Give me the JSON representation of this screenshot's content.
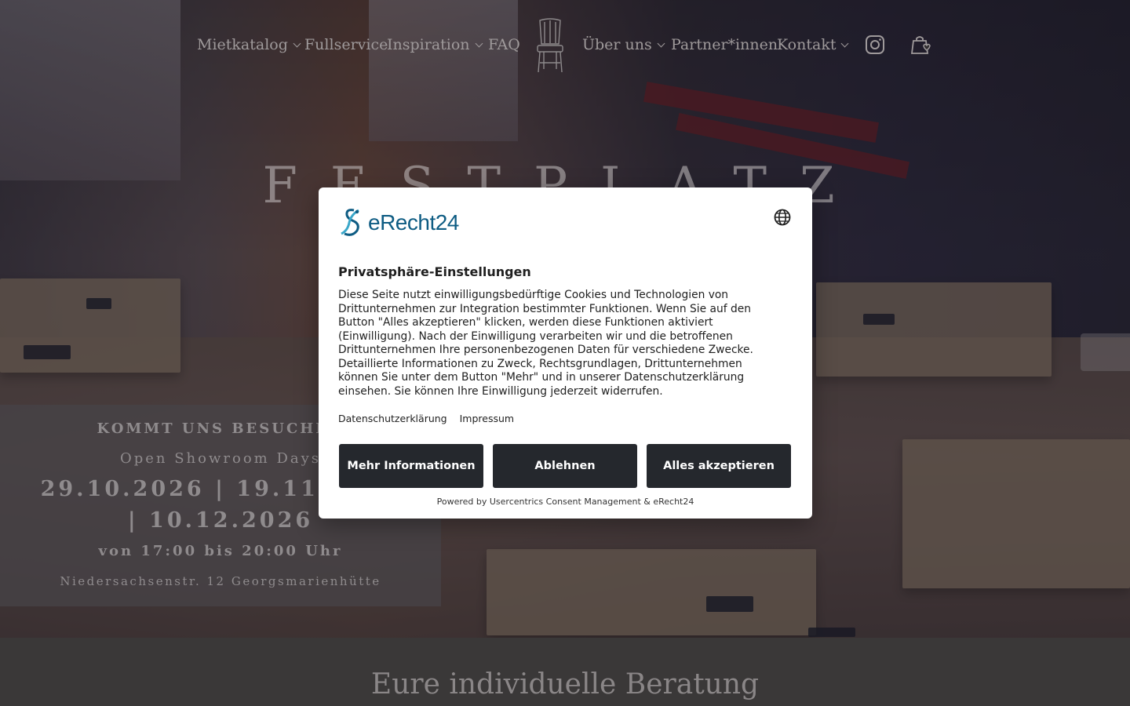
{
  "nav": {
    "items": [
      {
        "label": "Mietkatalog",
        "dropdown": true
      },
      {
        "label": "Fullservice",
        "dropdown": false
      },
      {
        "label": "Inspiration",
        "dropdown": true
      },
      {
        "label": "FAQ",
        "dropdown": false
      },
      {
        "label": "Über uns",
        "dropdown": true
      },
      {
        "label": "Partner*innen",
        "dropdown": false
      },
      {
        "label": "Kontakt",
        "dropdown": true
      }
    ],
    "icons": [
      "instagram-icon",
      "shopping-bag-heart-icon"
    ]
  },
  "hero": {
    "title": "FESTPLATZ"
  },
  "showroom": {
    "heading": "KOMMT UNS BESUCHEN",
    "subheading": "Open Showroom Days",
    "dates": "29.10.2026 | 19.11.2026 | 10.12.2026",
    "time": "von 17:00 bis 20:00 Uhr",
    "address": "Niedersachsenstr. 12 Georgsmarienhütte"
  },
  "section": {
    "title": "Eure individuelle Beratung"
  },
  "consent": {
    "brand": "eRecht24",
    "title": "Privatsphäre-Einstellungen",
    "body": "Diese Seite nutzt einwilligungsbedürftige Cookies und Technologien von Drittunternehmen zur Integration bestimmter Funktionen. Wenn Sie auf den Button \"Alles akzeptieren\" klicken, werden diese Funktionen aktiviert (Einwilligung). Nach der Einwilligung verarbeiten wir und die betroffenen Drittunternehmen Ihre personenbezogenen Daten für verschiedene Zwecke. Detaillierte Informationen zu Zweck, Rechtsgrundlagen, Drittunternehmen können Sie unter dem Button \"Mehr\" und in unserer Datenschutzerklärung einsehen. Sie können Ihre Einwilligung jederzeit widerrufen.",
    "links": {
      "privacy": "Datenschutzerklärung",
      "imprint": "Impressum"
    },
    "buttons": {
      "more": "Mehr Informationen",
      "deny": "Ablehnen",
      "accept": "Alles akzeptieren"
    },
    "powered": "Powered by Usercentrics Consent Management & eRecht24",
    "brand_color": "#0e5c83",
    "button_color": "#25282d"
  }
}
